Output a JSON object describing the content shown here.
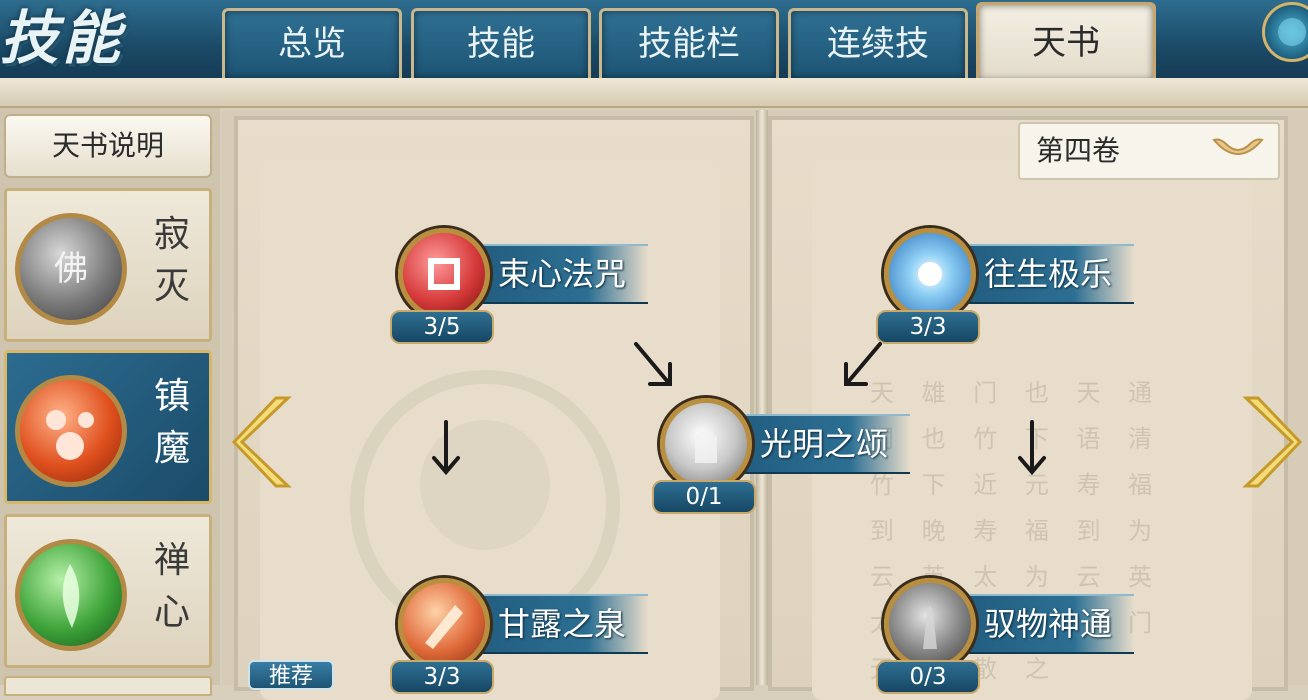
{
  "header": {
    "logo_text": "技能",
    "tabs": [
      {
        "label": "总览",
        "active": false
      },
      {
        "label": "技能",
        "active": false
      },
      {
        "label": "技能栏",
        "active": false
      },
      {
        "label": "连续技",
        "active": false
      },
      {
        "label": "天书",
        "active": true
      }
    ]
  },
  "sidebar": {
    "description_button": "天书说明",
    "schools": [
      {
        "name_line1": "寂",
        "name_line2": "灭",
        "emblem_icon": "buddha-icon",
        "color": "#8a8a8a",
        "active": false
      },
      {
        "name_line1": "镇",
        "name_line2": "魔",
        "emblem_icon": "demon-seal-icon",
        "color": "#d9532a",
        "active": true
      },
      {
        "name_line1": "禅",
        "name_line2": "心",
        "emblem_icon": "lotus-hand-icon",
        "color": "#3a9a3a",
        "active": false
      }
    ]
  },
  "book": {
    "volume_select": "第四卷",
    "skills": [
      {
        "name": "束心法咒",
        "level": "3/5",
        "icon": "swastika-seal-icon",
        "color": "#d63a3a"
      },
      {
        "name": "往生极乐",
        "level": "3/3",
        "icon": "radiant-light-icon",
        "color": "#5aa6e0"
      },
      {
        "name": "光明之颂",
        "level": "0/1",
        "icon": "glowing-hand-icon",
        "color": "#c8c8c8"
      },
      {
        "name": "甘露之泉",
        "level": "3/3",
        "icon": "crystal-spring-icon",
        "color": "#e06a3a"
      },
      {
        "name": "驭物神通",
        "level": "0/3",
        "icon": "spirit-figure-icon",
        "color": "#7a7a7a"
      }
    ],
    "recommend_button": "推荐",
    "ghost_text": "天 雄 门 也 天 通 门 也 竹 下 语 清 竹 下 近 元 寿 福 到 晚 寿 福 到 为 云 英 太 为 云 英 太 门 无 涛 登 门 无 涛 散 之"
  }
}
